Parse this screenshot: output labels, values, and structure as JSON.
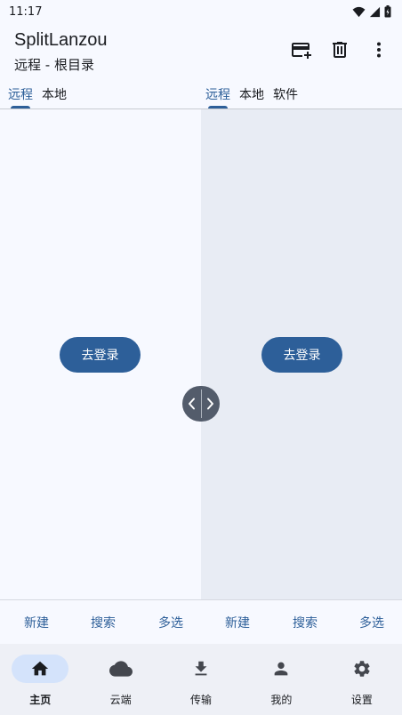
{
  "status_bar": {
    "time": "11:17"
  },
  "app_bar": {
    "title": "SplitLanzou",
    "subtitle": "远程 - 根目录",
    "actions": [
      "add-card-icon",
      "delete-icon",
      "more-vert-icon"
    ]
  },
  "left_pane": {
    "tabs": [
      {
        "label": "远程",
        "active": true
      },
      {
        "label": "本地",
        "active": false
      }
    ],
    "login_label": "去登录",
    "actions": [
      "新建",
      "搜索",
      "多选"
    ]
  },
  "right_pane": {
    "tabs": [
      {
        "label": "远程",
        "active": true
      },
      {
        "label": "本地",
        "active": false
      },
      {
        "label": "软件",
        "active": false
      }
    ],
    "login_label": "去登录",
    "actions": [
      "新建",
      "搜索",
      "多选"
    ]
  },
  "nav": {
    "items": [
      {
        "label": "主页",
        "icon": "home-icon",
        "active": true
      },
      {
        "label": "云端",
        "icon": "cloud-icon",
        "active": false
      },
      {
        "label": "传输",
        "icon": "download-icon",
        "active": false
      },
      {
        "label": "我的",
        "icon": "person-icon",
        "active": false
      },
      {
        "label": "设置",
        "icon": "settings-icon",
        "active": false
      }
    ]
  },
  "colors": {
    "accent": "#2d5f99",
    "background": "#f7f9ff",
    "right_pane_background": "#e8ecf4",
    "nav_background": "#eef0f6",
    "nav_active_pill": "#d4e3fb"
  }
}
